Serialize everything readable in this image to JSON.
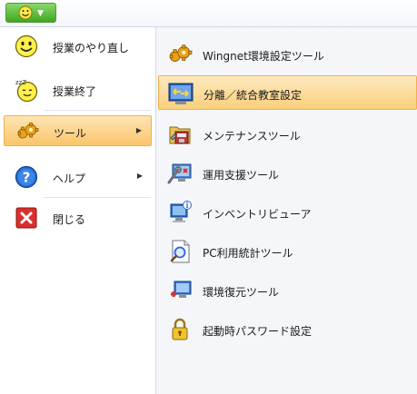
{
  "toolbar": {
    "app_button_icon": "smiley-icon",
    "app_button_caret": "▼"
  },
  "menu": {
    "items": [
      {
        "label": "授業のやり直し",
        "icon": "smiley-icon"
      },
      {
        "label": "授業終了",
        "icon": "sleeping-smiley-icon"
      },
      {
        "label": "ツール",
        "icon": "puzzle-gear-icon",
        "active": true,
        "arrow": "▶"
      },
      {
        "label": "ヘルプ",
        "icon": "help-icon",
        "arrow": "▶"
      },
      {
        "label": "閉じる",
        "icon": "close-icon"
      }
    ]
  },
  "submenu": {
    "items": [
      {
        "label": "Wingnet環境設定ツール",
        "icon": "puzzle-gear-icon"
      },
      {
        "label": "分離／統合教室設定",
        "icon": "classroom-split-icon",
        "active": true
      },
      {
        "label": "メンテナンスツール",
        "icon": "maintenance-icon"
      },
      {
        "label": "運用支援ツール",
        "icon": "support-tool-icon"
      },
      {
        "label": "インベントリビューア",
        "icon": "inventory-viewer-icon"
      },
      {
        "label": "PC利用統計ツール",
        "icon": "stats-search-icon"
      },
      {
        "label": "環境復元ツール",
        "icon": "restore-icon"
      },
      {
        "label": "起動時パスワード設定",
        "icon": "padlock-icon"
      }
    ]
  },
  "colors": {
    "accent": "#fbc56b",
    "app_button": "#3fa822"
  }
}
